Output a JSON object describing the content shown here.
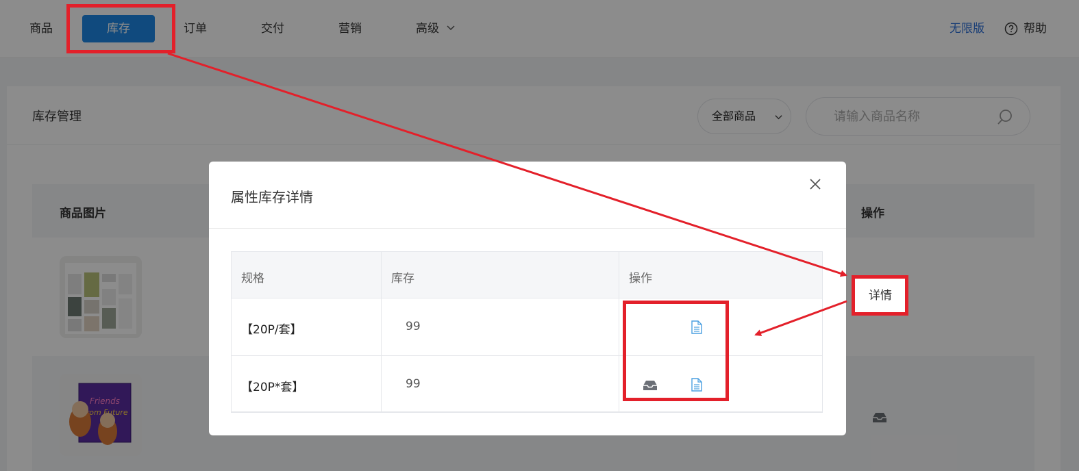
{
  "topnav": {
    "items": [
      {
        "label": "商品"
      },
      {
        "label": "库存",
        "active": true
      },
      {
        "label": "订单"
      },
      {
        "label": "交付"
      },
      {
        "label": "营销"
      },
      {
        "label": "高级",
        "has_dropdown": true
      }
    ],
    "plan_link": "无限版",
    "help_label": "帮助"
  },
  "page": {
    "title": "库存管理",
    "filter_label": "全部商品",
    "search_placeholder": "请输入商品名称",
    "table_headers": {
      "image": "商品图片",
      "action": "操作"
    },
    "row_action_label": "详情"
  },
  "modal": {
    "title": "属性库存详情",
    "columns": [
      "规格",
      "库存",
      "操作"
    ],
    "rows": [
      {
        "spec": "【20P/套】",
        "stock": "99",
        "actions": [
          "document-icon"
        ]
      },
      {
        "spec": "【20P*套】",
        "stock": "99",
        "actions": [
          "inbox-icon",
          "document-icon"
        ]
      }
    ]
  },
  "annotation": {
    "detail_label": "详情"
  },
  "colors": {
    "accent": "#1e88e5",
    "link": "#2d6fd7",
    "annotation_red": "#e3202a",
    "doc_icon": "#4a9fe0"
  }
}
